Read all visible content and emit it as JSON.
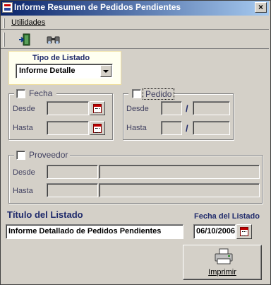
{
  "window": {
    "title": "Informe Resumen de Pedidos Pendientes",
    "close_symbol": "×"
  },
  "menu": {
    "items": [
      {
        "label": "Utilidades"
      }
    ]
  },
  "toolbar": {
    "buttons": [
      {
        "icon": "exit-door-icon"
      },
      {
        "icon": "binoculars-icon"
      }
    ]
  },
  "tipo_listado": {
    "label": "Tipo de Listado",
    "selected": "Informe Detalle"
  },
  "fecha": {
    "label": "Fecha",
    "checked": false,
    "desde_label": "Desde",
    "hasta_label": "Hasta",
    "desde_value": "",
    "hasta_value": ""
  },
  "pedido": {
    "label": "Pedido",
    "checked": false,
    "desde_label": "Desde",
    "hasta_label": "Hasta",
    "separator": "/"
  },
  "proveedor": {
    "label": "Proveedor",
    "checked": false,
    "desde_label": "Desde",
    "hasta_label": "Hasta"
  },
  "titulo": {
    "label": "Título del Listado",
    "value": "Informe Detallado de Pedidos Pendientes"
  },
  "fecha_listado": {
    "label": "Fecha del Listado",
    "value": "06/10/2006"
  },
  "print": {
    "label": "Imprimir"
  },
  "colors": {
    "titlebar_start": "#0a246a",
    "titlebar_end": "#a6caf0",
    "face": "#d4d0c8",
    "label_blue": "#1f2a6b",
    "panel_bg": "#fffff0"
  }
}
